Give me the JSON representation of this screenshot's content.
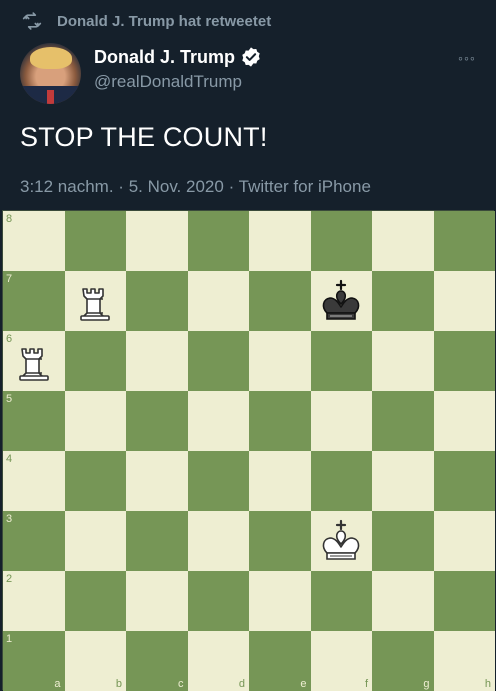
{
  "retweet": {
    "text": "Donald J. Trump hat retweetet",
    "icon": "retweet-icon"
  },
  "user": {
    "name": "Donald J. Trump",
    "handle": "@realDonaldTrump",
    "verified": true
  },
  "more_label": "◦◦◦",
  "tweet": {
    "text": "STOP THE COUNT!"
  },
  "meta": {
    "time": "3:12 nachm.",
    "date": "5. Nov. 2020",
    "source": "Twitter for iPhone"
  },
  "board": {
    "files": [
      "a",
      "b",
      "c",
      "d",
      "e",
      "f",
      "g",
      "h"
    ],
    "ranks": [
      "8",
      "7",
      "6",
      "5",
      "4",
      "3",
      "2",
      "1"
    ],
    "colors": {
      "light": "#eeeed2",
      "dark": "#769656"
    },
    "pieces": [
      {
        "type": "rook",
        "color": "white",
        "square": "b7"
      },
      {
        "type": "king",
        "color": "black",
        "square": "f7"
      },
      {
        "type": "rook",
        "color": "white",
        "square": "a6"
      },
      {
        "type": "king",
        "color": "white",
        "square": "f3"
      }
    ]
  }
}
